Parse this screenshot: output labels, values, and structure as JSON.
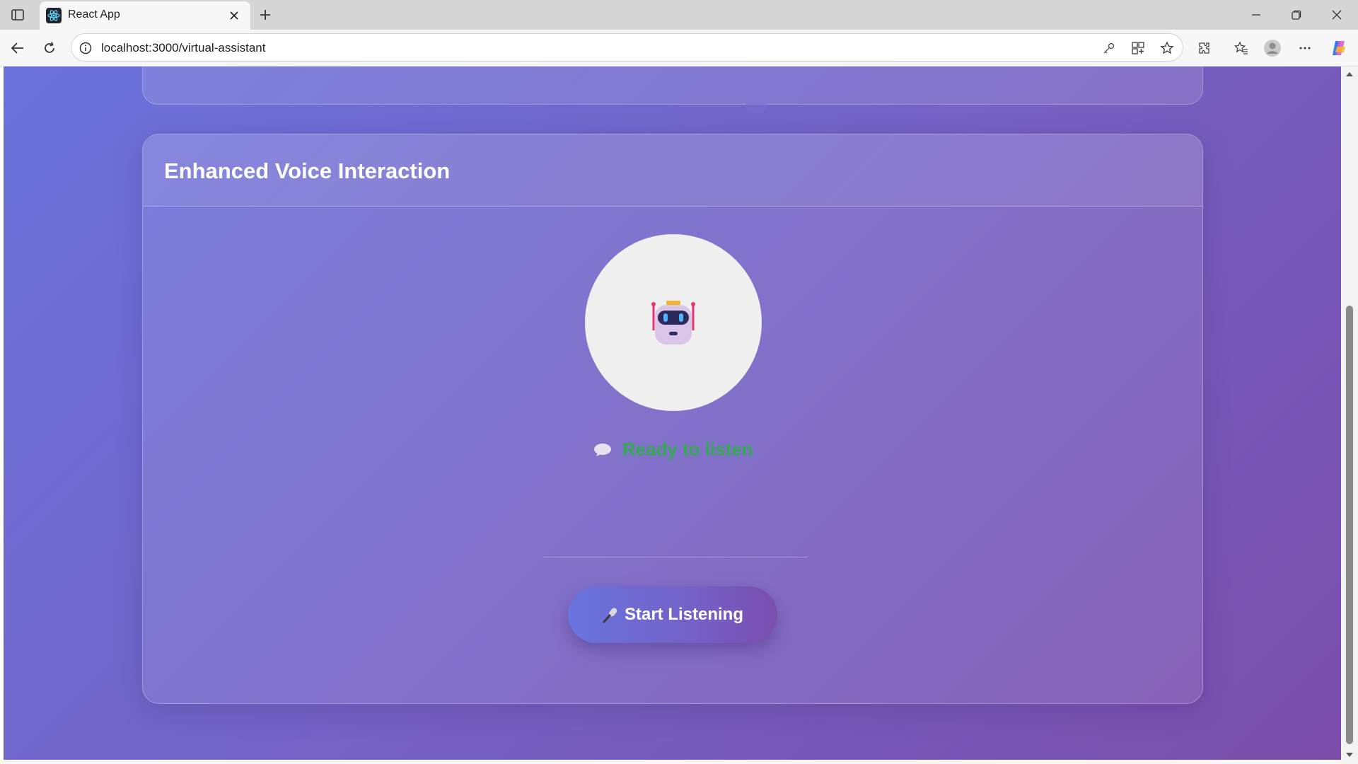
{
  "browser": {
    "tab_title": "React App",
    "url": "localhost:3000/virtual-assistant",
    "icons": [
      "sidebar-toggle-icon",
      "react-logo-icon",
      "close-icon",
      "plus-icon",
      "minimize-icon",
      "restore-icon",
      "close-window-icon",
      "back-arrow-icon",
      "reload-icon",
      "info-icon",
      "key-icon",
      "app-grid-icon",
      "star-icon",
      "extensions-icon",
      "favorites-icon",
      "profile-icon",
      "more-icon",
      "copilot-icon"
    ]
  },
  "page": {
    "card_title": "Enhanced Voice Interaction",
    "avatar_icon": "robot-icon",
    "status_text": "Ready to listen",
    "status_icon": "speech-bubble-icon",
    "status_color": "#34a853",
    "start_button_label": "Start Listening",
    "start_button_icon": "microphone-icon",
    "background_gradient": [
      "#6b72dc",
      "#7a4da9"
    ]
  }
}
